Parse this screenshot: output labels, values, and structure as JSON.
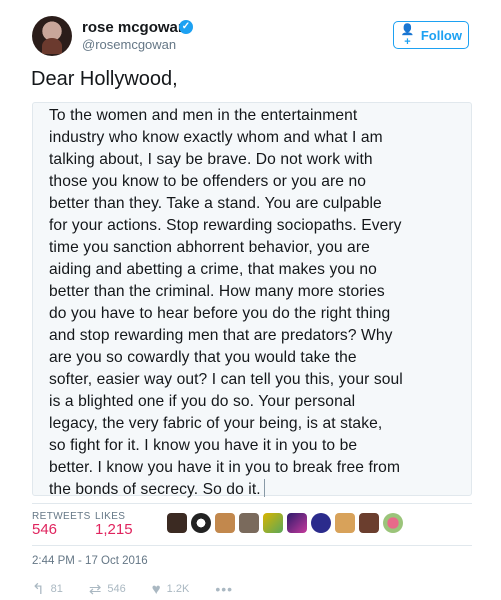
{
  "header": {
    "name": "rose mcgowan",
    "verified_icon": "verified-badge-icon",
    "handle": "@rosemcgowan",
    "follow_label": "Follow"
  },
  "tweet": {
    "text": "Dear Hollywood,",
    "quote_lines": [
      "To the women and men in the entertainment",
      "industry who know exactly whom and what I am",
      "talking about, I say be brave. Do not work with",
      "those you know to be offenders or you are no",
      "better than they. Take a stand. You are culpable",
      "for your actions. Stop rewarding sociopaths. Every",
      "time you sanction abhorrent behavior, you are",
      "aiding and abetting a crime, that makes you no",
      "better than the criminal. How many more stories",
      "do you have to hear before you do the right thing",
      "and stop rewarding men that are predators? Why",
      "are you so cowardly that you would take the",
      "softer, easier way out? I can tell you this, your soul",
      "is a blighted one if you do so. Your personal",
      "legacy, the very fabric of your being, is at stake,",
      "so fight for it. I know you have it in you to be",
      "better. I know you have it in you to break free from",
      "the bonds of secrecy. So do it."
    ]
  },
  "stats": {
    "retweets_label": "RETWEETS",
    "retweets_value": "546",
    "likes_label": "LIKES",
    "likes_value": "1,215"
  },
  "timestamp": "2:44 PM - 17 Oct 2016",
  "actions": {
    "reply_count": "81",
    "retweet_count": "546",
    "like_count": "1.2K",
    "more_icon": "more-dots-icon"
  },
  "colors": {
    "accent": "#1da1f2",
    "likes": "#e0245e",
    "muted": "#657786"
  }
}
